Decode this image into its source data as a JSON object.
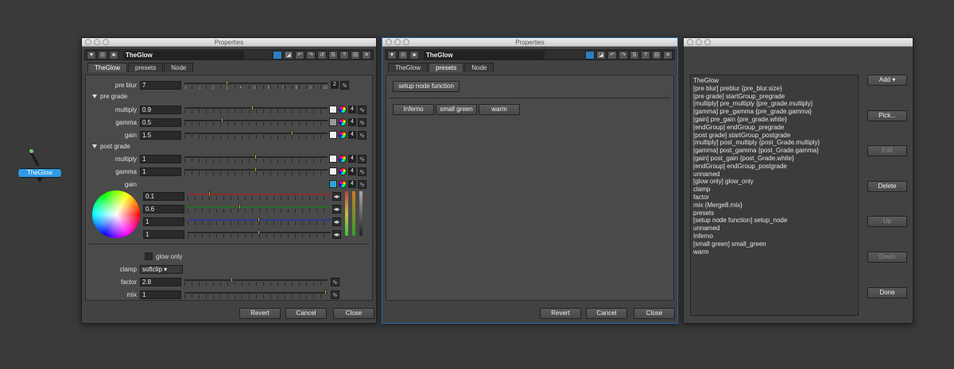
{
  "node": {
    "label": "TheGlow"
  },
  "window_title": "Properties",
  "panel1": {
    "node_name": "TheGlow",
    "tabs": [
      "TheGlow",
      "presets",
      "Node"
    ],
    "tick_labels": [
      "0",
      "1",
      "2",
      "3",
      "4",
      "5",
      "6",
      "7",
      "8",
      "9",
      "10"
    ],
    "pre_blur": {
      "label": "pre blur",
      "value": "7",
      "right_val": "2"
    },
    "pre_grade": {
      "label": "pre grade"
    },
    "pre_multiply": {
      "label": "multiply",
      "value": "0.9"
    },
    "pre_gamma": {
      "label": "gamma",
      "value": "0.5"
    },
    "pre_gain": {
      "label": "gain",
      "value": "1.5"
    },
    "post_grade": {
      "label": "post grade"
    },
    "post_multiply": {
      "label": "multiply",
      "value": "1"
    },
    "post_gamma": {
      "label": "gamma",
      "value": "1"
    },
    "post_gain": {
      "label": "gain"
    },
    "rgba": [
      "0.1",
      "0.6",
      "1",
      "1"
    ],
    "count_label": "4",
    "glow_only": "glow only",
    "clamp": {
      "label": "clamp",
      "value": "softclip"
    },
    "factor": {
      "label": "factor",
      "value": "2.8"
    },
    "mix": {
      "label": "mix",
      "value": "1"
    },
    "buttons": {
      "revert": "Revert",
      "cancel": "Cancel",
      "close": "Close"
    }
  },
  "panel2": {
    "node_name": "TheGlow",
    "tabs": [
      "TheGlow",
      "presets",
      "Node"
    ],
    "setup_button": "setup node function",
    "preset_buttons": [
      "Inferno",
      "small green",
      "warm"
    ],
    "buttons": {
      "revert": "Revert",
      "cancel": "Cancel",
      "close": "Close"
    }
  },
  "panel3": {
    "items": [
      "TheGlow",
      "[pre blur] preblur {pre_blur.size}",
      "[pre grade] startGroup_pregrade",
      "[multiply] pre_multiply {pre_grade.multiply}",
      "[gamma] pre_gamma {pre_grade.gamma}",
      "[gain] pre_gain {pre_grade.white}",
      "[endGroup] endGroup_pregrade",
      "[post grade] startGroup_postgrade",
      "[multiply] post_multiply {post_Grade.multiply}",
      "[gamma] post_gamma {post_Grade.gamma}",
      "[gain] post_gain {post_Grade.white}",
      "[endGroup] endGroup_postgrade",
      "unnamed",
      "[glow only] glow_only",
      "clamp",
      "factor",
      "mix {Merge8.mix}",
      "presets",
      "[setup node function] setup_node",
      "unnamed",
      "Inferno",
      "[small green] small_green",
      "warm"
    ],
    "buttons": {
      "add": "Add",
      "pick": "Pick...",
      "edit": "Edit",
      "delete": "Delete",
      "up": "Up",
      "down": "Down",
      "done": "Done"
    }
  }
}
